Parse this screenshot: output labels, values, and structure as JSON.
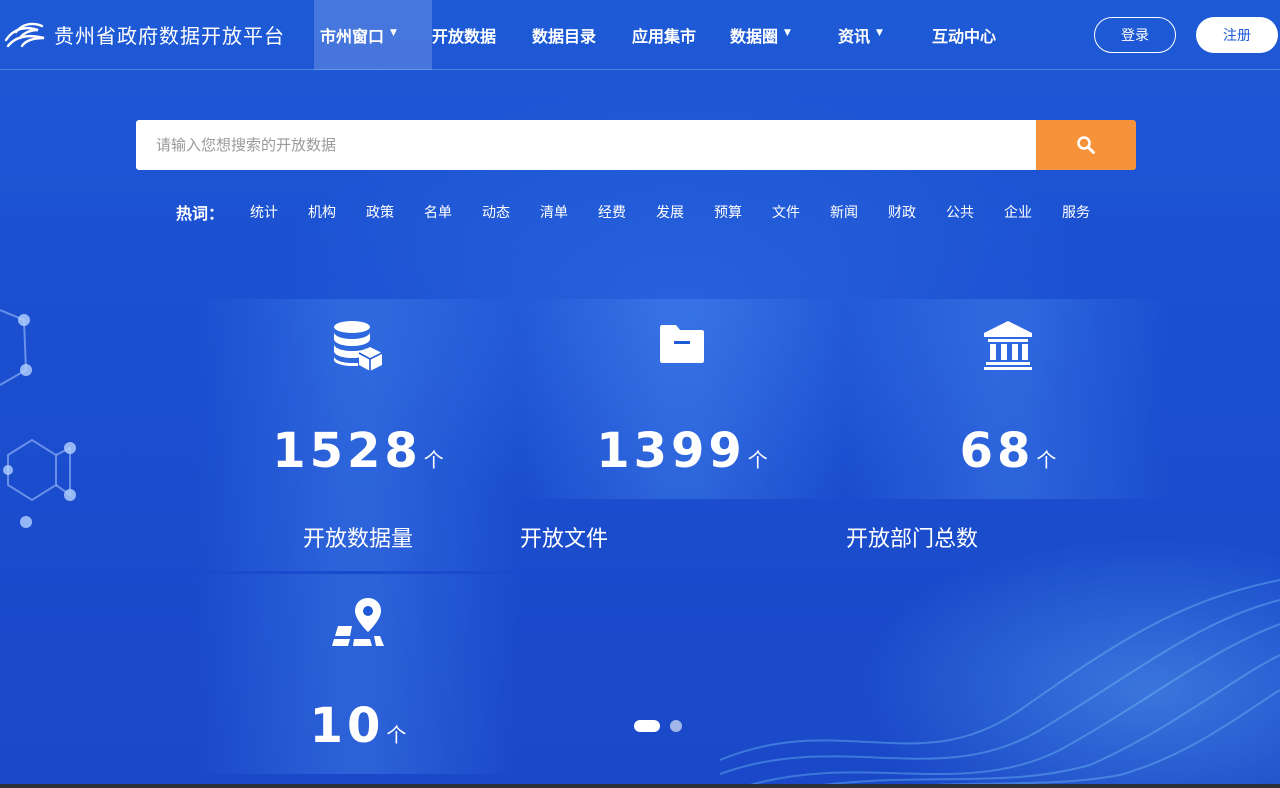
{
  "header": {
    "site_title": "贵州省政府数据开放平台",
    "nav": [
      {
        "label": "市州窗口",
        "caret": true,
        "active": true
      },
      {
        "label": "开放数据",
        "caret": false,
        "active": false
      },
      {
        "label": "数据目录",
        "caret": false,
        "active": false
      },
      {
        "label": "应用集市",
        "caret": false,
        "active": false
      },
      {
        "label": "数据圈",
        "caret": true,
        "active": false
      },
      {
        "label": "资讯",
        "caret": true,
        "active": false
      },
      {
        "label": "互动中心",
        "caret": false,
        "active": false
      }
    ],
    "login_label": "登录",
    "register_label": "注册"
  },
  "search": {
    "placeholder": "请输入您想搜索的开放数据",
    "button_icon": "search-icon"
  },
  "hot_words": {
    "label": "热词：",
    "items": [
      "统计",
      "机构",
      "政策",
      "名单",
      "动态",
      "清单",
      "经费",
      "发展",
      "预算",
      "文件",
      "新闻",
      "财政",
      "公共",
      "企业",
      "服务"
    ]
  },
  "stats": [
    {
      "icon": "database-icon",
      "value": "1528",
      "unit": "个",
      "label": "开放数据量"
    },
    {
      "icon": "folder-icon",
      "value": "1399",
      "unit": "个",
      "label": "开放文件"
    },
    {
      "icon": "institution-icon",
      "value": "68",
      "unit": "个",
      "label": "开放部门总数"
    },
    {
      "icon": "map-pin-icon",
      "value": "10",
      "unit": "个",
      "label": ""
    }
  ],
  "carousel": {
    "slides": 2,
    "active_index": 0
  },
  "colors": {
    "background": "#1b4fd0",
    "search_button": "#f6923a",
    "register_text": "#1b59d6"
  }
}
